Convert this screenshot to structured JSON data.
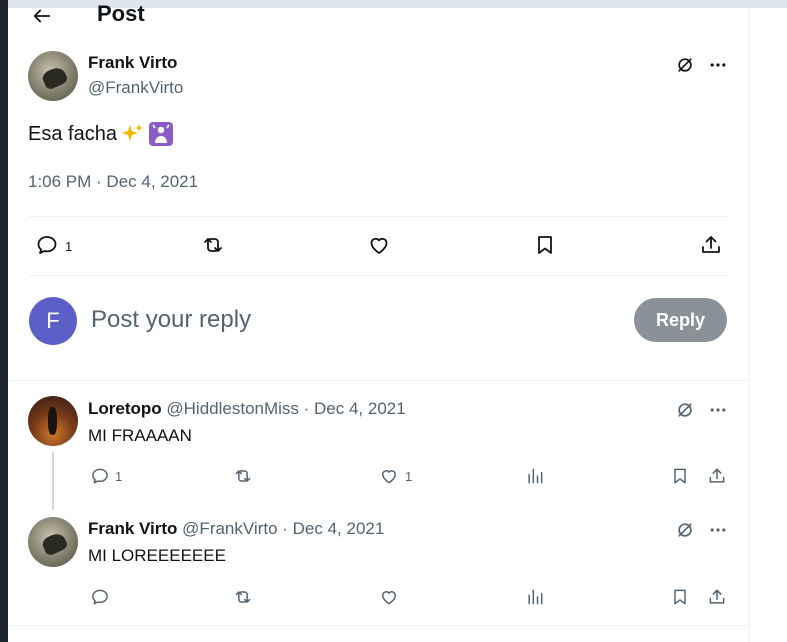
{
  "header": {
    "title": "Post",
    "back_icon": "arrow-left-icon"
  },
  "post": {
    "author_name": "Frank Virto",
    "author_handle": "@FrankVirto",
    "text": "Esa facha",
    "emojis": [
      "sparkles-emoji",
      "woman-gesturing-emoji"
    ],
    "timestamp": "1:06 PM · Dec 4, 2021",
    "reply_count": "1",
    "grok_icon": "grok-icon",
    "more_icon": "more-icon"
  },
  "composer": {
    "avatar_letter": "F",
    "placeholder": "Post your reply",
    "button_label": "Reply",
    "avatar_color": "#5b5fc7"
  },
  "replies": [
    {
      "name": "Loretopo",
      "meta": "@HiddlestonMiss · Dec 4, 2021",
      "text": "MI FRAAAAN",
      "reply_count": "1",
      "like_count": "1"
    },
    {
      "name": "Frank Virto",
      "meta": "@FrankVirto · Dec 4, 2021",
      "text": "MI LOREEEEEEE",
      "reply_count": "",
      "like_count": ""
    }
  ]
}
